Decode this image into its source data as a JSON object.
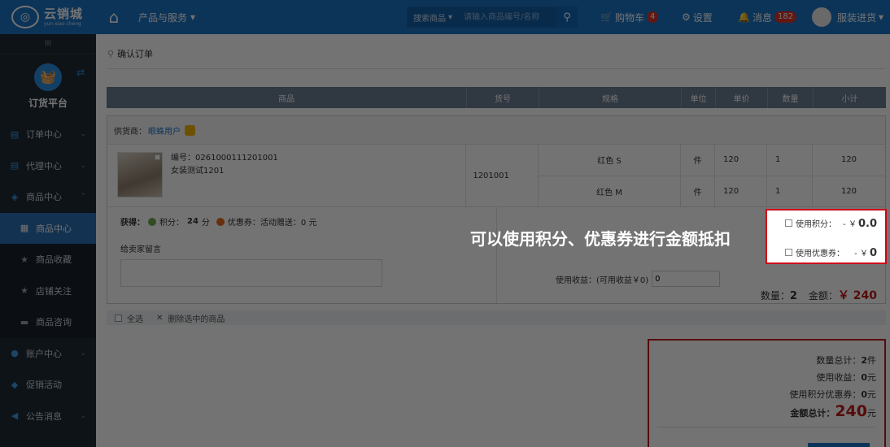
{
  "topbar": {
    "logo_cn": "云销城",
    "logo_en": "yun xiao cheng",
    "nav_products": "产品与服务",
    "search_type": "搜索商品",
    "search_placeholder": "请输入商品编号/名称",
    "cart_label": "购物车",
    "cart_count": "4",
    "settings_label": "设置",
    "messages_label": "消息",
    "messages_count": "182",
    "user_label": "服装进货"
  },
  "sidebar": {
    "platform_label": "订货平台",
    "items": [
      {
        "label": "订单中心",
        "icon": "document-icon"
      },
      {
        "label": "代理中心",
        "icon": "document-icon"
      },
      {
        "label": "商品中心",
        "icon": "bag-icon"
      },
      {
        "label": "商品中心",
        "icon": "grid-icon"
      },
      {
        "label": "商品收藏",
        "icon": "star-icon"
      },
      {
        "label": "店铺关注",
        "icon": "star-icon"
      },
      {
        "label": "商品咨询",
        "icon": "chat-icon"
      },
      {
        "label": "账户中心",
        "icon": "user-icon"
      },
      {
        "label": "促销活动",
        "icon": "tag-icon"
      },
      {
        "label": "公告消息",
        "icon": "speaker-icon"
      }
    ]
  },
  "breadcrumb": "确认订单",
  "table": {
    "headers": [
      "商品",
      "货号",
      "规格",
      "单位",
      "单价",
      "数量",
      "小计"
    ]
  },
  "order": {
    "supplier_label": "供货商：",
    "supplier_name": "眼蛛用户",
    "product_code_line": "编号：0261000111201001",
    "product_name": "女装测试1201",
    "sku": "1201001",
    "specs": [
      {
        "spec": "红色 S",
        "unit": "件",
        "price": "120",
        "qty": "1",
        "subtotal": "120"
      },
      {
        "spec": "红色 M",
        "unit": "件",
        "price": "120",
        "qty": "1",
        "subtotal": "120"
      }
    ],
    "earn_label": "获得：",
    "points_label": "积分：",
    "points_value": "24",
    "points_unit": "分",
    "coupon_label": "优惠券：活动赠送：0 元",
    "message_label": "给卖家留言",
    "income_label": "使用收益：(可用收益￥0)",
    "income_value": "0",
    "qty_label": "数量：",
    "qty_value": "2",
    "amount_label": "金额：",
    "amount_value": "￥ 240"
  },
  "select_bar": {
    "select_all": "全选",
    "delete_selected": "删除选中的商品"
  },
  "summary": {
    "qty_total_label": "数量总计：",
    "qty_total_value": "2",
    "qty_total_unit": "件",
    "income_label": "使用收益：",
    "income_value": "0",
    "income_unit": "元",
    "points_coupon_label": "使用积分优惠券：",
    "points_coupon_value": "0",
    "points_coupon_unit": "元",
    "amount_total_label": "金额总计：",
    "amount_total_value": "240",
    "amount_total_unit": "元"
  },
  "callout": {
    "text": "可以使用积分、优惠券进行金额抵扣",
    "use_points_label": "使用积分：",
    "use_points_prefix": "- ￥",
    "use_points_value": "0.0",
    "use_coupon_label": "使用优惠券：",
    "use_coupon_prefix": "- ￥",
    "use_coupon_value": "0"
  },
  "colors": {
    "topbar": "#1c74c4",
    "sidebar": "#1f2a36",
    "accent_red": "#c21a1a",
    "highlight_border": "#d0021b"
  }
}
